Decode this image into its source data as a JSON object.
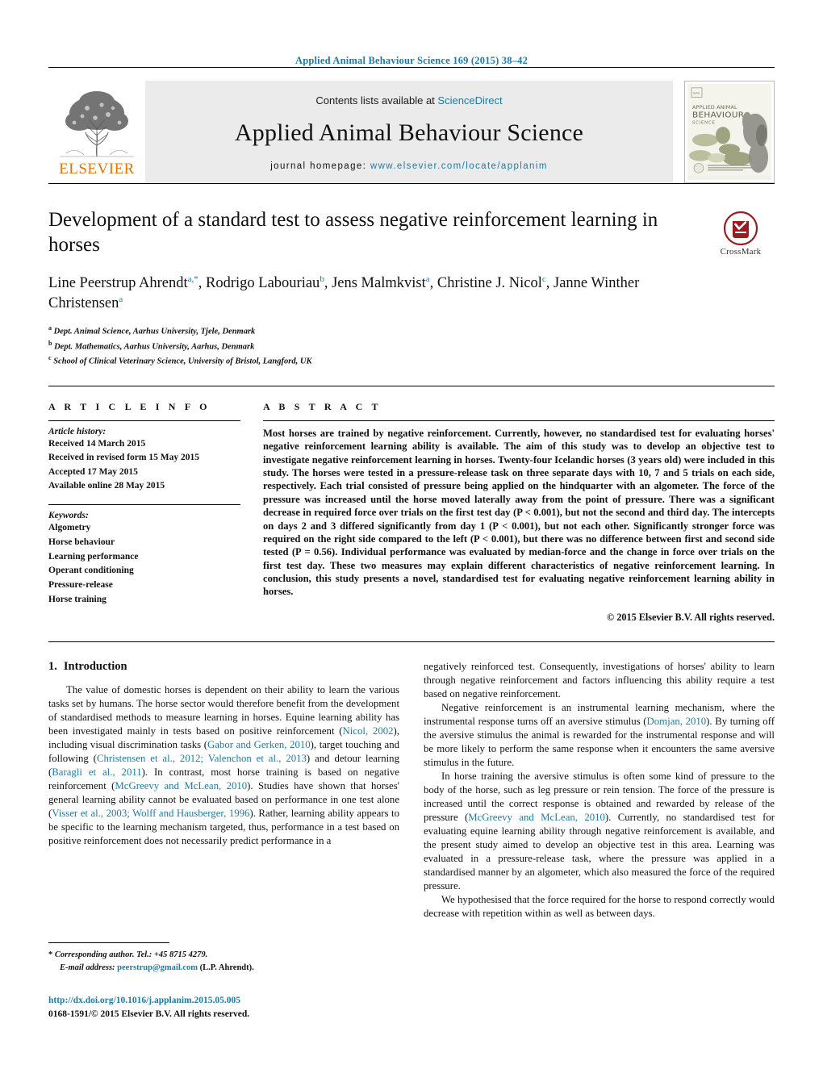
{
  "running_head": "Applied Animal Behaviour Science 169 (2015) 38–42",
  "banner": {
    "publisher_logo_text": "ELSEVIER",
    "contents_prefix": "Contents lists available at ",
    "contents_link": "ScienceDirect",
    "journal_title": "Applied Animal Behaviour Science",
    "homepage_prefix": "journal homepage: ",
    "homepage_url": "www.elsevier.com/locate/applanim",
    "cover_alt_lines": [
      "APPLIED ANIMAL",
      "BEHAVIOUR",
      "SCIENCE"
    ]
  },
  "crossmark": {
    "label": "CrossMark",
    "accent_color": "#9b1c20"
  },
  "article": {
    "title": "Development of a standard test to assess negative reinforcement learning in horses",
    "authors_html": "Line Peerstrup Ahrendt<sup>a,*</sup>, Rodrigo Labouriau<sup>b</sup>, Jens Malmkvist<sup>a</sup>, Christine J. Nicol<sup>c</sup>, Janne Winther Christensen<sup>a</sup>",
    "affiliations": [
      {
        "marker": "a",
        "text": "Dept. Animal Science, Aarhus University, Tjele, Denmark"
      },
      {
        "marker": "b",
        "text": "Dept. Mathematics, Aarhus University, Aarhus, Denmark"
      },
      {
        "marker": "c",
        "text": "School of Clinical Veterinary Science, University of Bristol, Langford, UK"
      }
    ]
  },
  "article_info": {
    "heading": "A R T I C L E   I N F O",
    "history_label": "Article history:",
    "history": [
      "Received 14 March 2015",
      "Received in revised form 15 May 2015",
      "Accepted 17 May 2015",
      "Available online 28 May 2015"
    ],
    "keywords_label": "Keywords:",
    "keywords": [
      "Algometry",
      "Horse behaviour",
      "Learning performance",
      "Operant conditioning",
      "Pressure-release",
      "Horse training"
    ]
  },
  "abstract": {
    "heading": "A B S T R A C T",
    "text": "Most horses are trained by negative reinforcement. Currently, however, no standardised test for evaluating horses' negative reinforcement learning ability is available. The aim of this study was to develop an objective test to investigate negative reinforcement learning in horses. Twenty-four Icelandic horses (3 years old) were included in this study. The horses were tested in a pressure-release task on three separate days with 10, 7 and 5 trials on each side, respectively. Each trial consisted of pressure being applied on the hindquarter with an algometer. The force of the pressure was increased until the horse moved laterally away from the point of pressure. There was a significant decrease in required force over trials on the first test day (P < 0.001), but not the second and third day. The intercepts on days 2 and 3 differed significantly from day 1 (P < 0.001), but not each other. Significantly stronger force was required on the right side compared to the left (P < 0.001), but there was no difference between first and second side tested (P = 0.56). Individual performance was evaluated by median-force and the change in force over trials on the first test day. These two measures may explain different characteristics of negative reinforcement learning. In conclusion, this study presents a novel, standardised test for evaluating negative reinforcement learning ability in horses.",
    "copyright": "© 2015 Elsevier B.V. All rights reserved."
  },
  "introduction": {
    "heading_number": "1.",
    "heading_text": "Introduction",
    "left_paragraphs": [
      {
        "parts": [
          {
            "t": "The value of domestic horses is dependent on their ability to learn the various tasks set by humans. The horse sector would therefore benefit from the development of standardised methods to measure learning in horses. Equine learning ability has been investigated mainly in tests based on positive reinforcement (",
            "ref": false
          },
          {
            "t": "Nicol, 2002",
            "ref": true
          },
          {
            "t": "), including visual discrimination tasks (",
            "ref": false
          },
          {
            "t": "Gabor and Gerken, 2010",
            "ref": true
          },
          {
            "t": "), target touching and following (",
            "ref": false
          },
          {
            "t": "Christensen et al., 2012; Valenchon et al., 2013",
            "ref": true
          },
          {
            "t": ") and detour learning (",
            "ref": false
          },
          {
            "t": "Baragli et al., 2011",
            "ref": true
          },
          {
            "t": "). In contrast, most horse training is based on negative reinforcement (",
            "ref": false
          },
          {
            "t": "McGreevy and McLean, 2010",
            "ref": true
          },
          {
            "t": "). Studies have shown that horses' general learning ability cannot be evaluated based on performance in one test alone (",
            "ref": false
          },
          {
            "t": "Visser et al., 2003; Wolff and Hausberger, 1996",
            "ref": true
          },
          {
            "t": "). Rather, learning ability appears to be specific to the learning mechanism targeted, thus, performance in a test based on positive reinforcement does not necessarily predict performance in a",
            "ref": false
          }
        ]
      }
    ],
    "right_paragraphs": [
      {
        "indent": false,
        "parts": [
          {
            "t": "negatively reinforced test. Consequently, investigations of horses' ability to learn through negative reinforcement and factors influencing this ability require a test based on negative reinforcement.",
            "ref": false
          }
        ]
      },
      {
        "indent": true,
        "parts": [
          {
            "t": "Negative reinforcement is an instrumental learning mechanism, where the instrumental response turns off an aversive stimulus (",
            "ref": false
          },
          {
            "t": "Domjan, 2010",
            "ref": true
          },
          {
            "t": "). By turning off the aversive stimulus the animal is rewarded for the instrumental response and will be more likely to perform the same response when it encounters the same aversive stimulus in the future.",
            "ref": false
          }
        ]
      },
      {
        "indent": true,
        "parts": [
          {
            "t": "In horse training the aversive stimulus is often some kind of pressure to the body of the horse, such as leg pressure or rein tension. The force of the pressure is increased until the correct response is obtained and rewarded by release of the pressure (",
            "ref": false
          },
          {
            "t": "McGreevy and McLean, 2010",
            "ref": true
          },
          {
            "t": "). Currently, no standardised test for evaluating equine learning ability through negative reinforcement is available, and the present study aimed to develop an objective test in this area. Learning was evaluated in a pressure-release task, where the pressure was applied in a standardised manner by an algometer, which also measured the force of the required pressure.",
            "ref": false
          }
        ]
      },
      {
        "indent": true,
        "parts": [
          {
            "t": "We hypothesised that the force required for the horse to respond correctly would decrease with repetition within as well as between days.",
            "ref": false
          }
        ]
      }
    ]
  },
  "footnotes": {
    "corresponding_marker": "*",
    "corresponding_text": "Corresponding author. Tel.: +45 8715 4279.",
    "email_label": "E-mail address:",
    "email": "peerstrup@gmail.com",
    "email_owner": "(L.P. Ahrendt).",
    "doi": "http://dx.doi.org/10.1016/j.applanim.2015.05.005",
    "issn_line": "0168-1591/© 2015 Elsevier B.V. All rights reserved."
  }
}
